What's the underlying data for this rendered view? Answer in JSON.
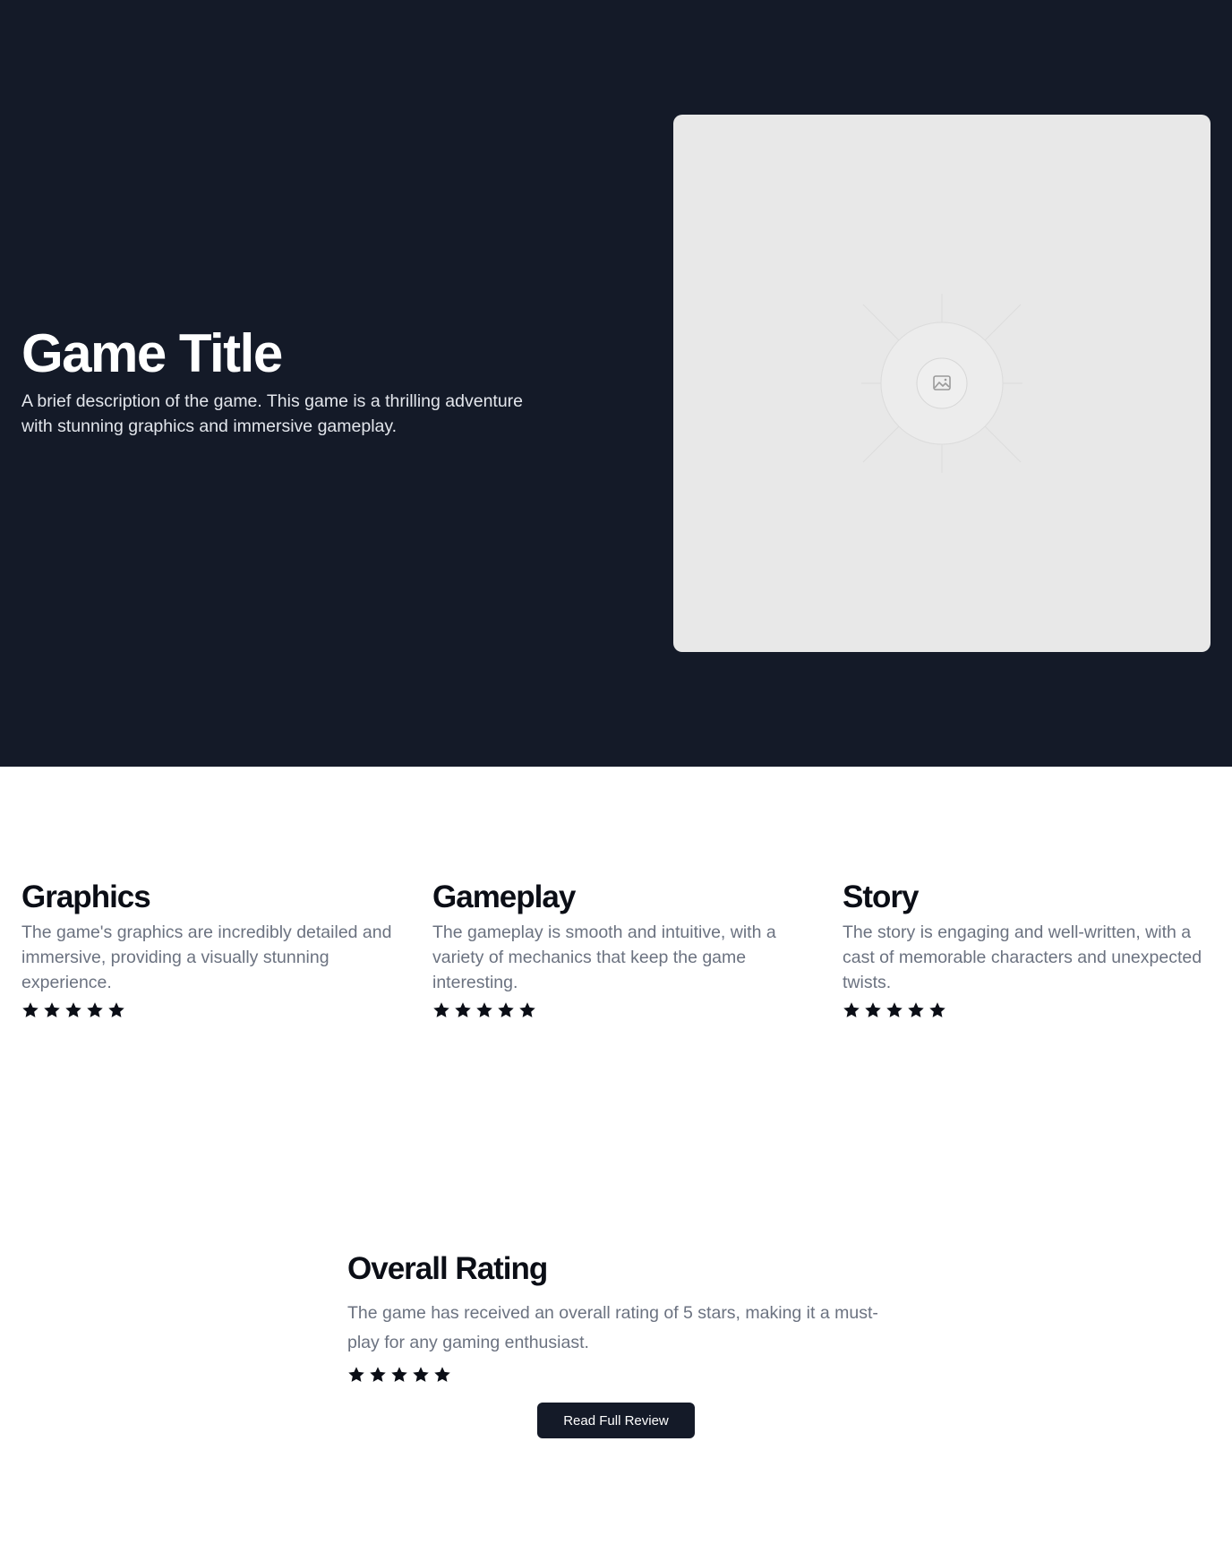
{
  "hero": {
    "title": "Game Title",
    "description": "A brief description of the game. This game is a thrilling adventure with stunning graphics and immersive gameplay.",
    "image_icon": "image-placeholder-icon"
  },
  "features": [
    {
      "title": "Graphics",
      "description": "The game's graphics are incredibly detailed and immersive, providing a visually stunning experience.",
      "rating": 5
    },
    {
      "title": "Gameplay",
      "description": "The gameplay is smooth and intuitive, with a variety of mechanics that keep the game interesting.",
      "rating": 5
    },
    {
      "title": "Story",
      "description": "The story is engaging and well-written, with a cast of memorable characters and unexpected twists.",
      "rating": 5
    }
  ],
  "overall": {
    "title": "Overall Rating",
    "description": "The game has received an overall rating of 5 stars, making it a must-play for any gaming enthusiast.",
    "rating": 5,
    "button_label": "Read Full Review"
  },
  "colors": {
    "hero_background": "#141a28",
    "image_background": "#e8e8e8",
    "heading_text": "#0b0e16",
    "body_text": "#6b7280",
    "button_background": "#141a28"
  }
}
